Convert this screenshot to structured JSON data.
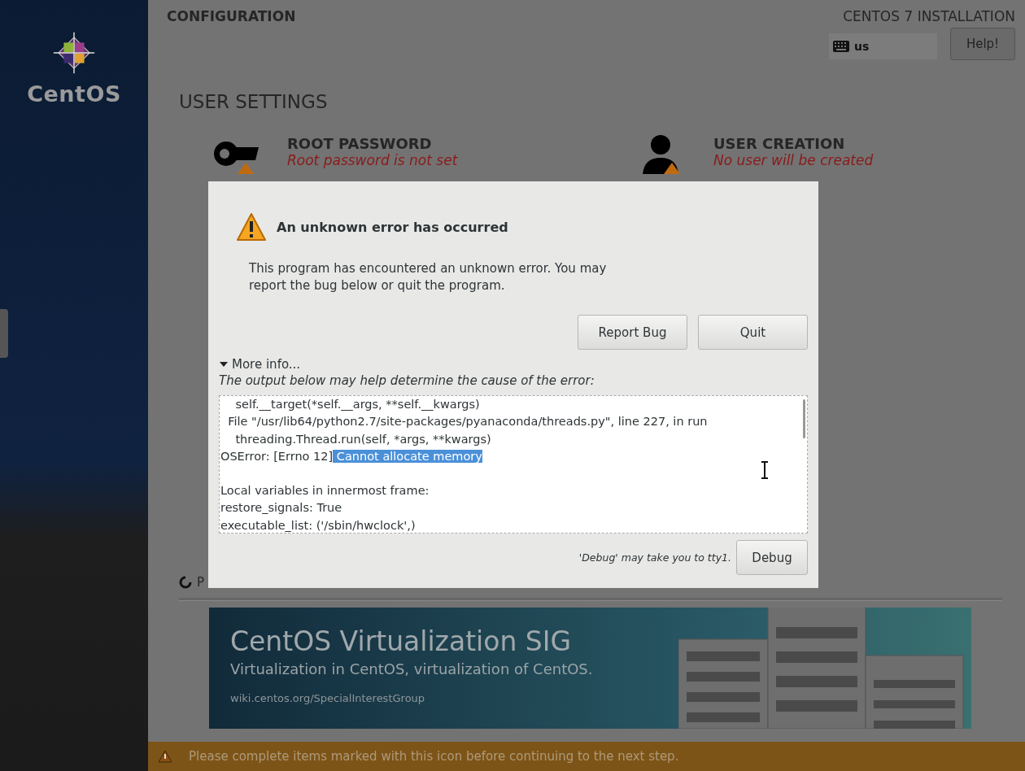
{
  "sidebar": {
    "logo_text": "CentOS"
  },
  "header": {
    "title": "CONFIGURATION",
    "product": "CENTOS 7 INSTALLATION",
    "keyboard_layout": "us",
    "help_button": "Help!"
  },
  "section_title": "USER SETTINGS",
  "spokes": [
    {
      "kind": "root",
      "title": "ROOT PASSWORD",
      "status": "Root password is not set",
      "warning": true
    },
    {
      "kind": "user",
      "title": "USER CREATION",
      "status": "No user will be created",
      "warning": true
    }
  ],
  "progress": {
    "text": "P"
  },
  "banner": {
    "title": "CentOS Virtualization SIG",
    "subtitle": "Virtualization in CentOS, virtualization of CentOS.",
    "url": "wiki.centos.org/SpecialInterestGroup"
  },
  "status_bar": {
    "message": "Please complete items marked with this icon before continuing to the next step."
  },
  "dialog": {
    "title": "An unknown error has occurred",
    "message": "This program has encountered an unknown error. You may report the bug below or quit the program.",
    "buttons": [
      "Report Bug",
      "Quit"
    ],
    "more_info": {
      "label": "More info...",
      "expanded": true
    },
    "hint": "The output below may help determine the cause of the error:",
    "log_lines": [
      {
        "text": "    self.__target(*self.__args, **self.__kwargs)"
      },
      {
        "text": "  File \"/usr/lib64/python2.7/site-packages/pyanaconda/threads.py\", line 227, in run"
      },
      {
        "text": "    threading.Thread.run(self, *args, **kwargs)"
      },
      {
        "text": "OSError: [Errno 12]",
        "selection": " Cannot allocate memory"
      },
      {
        "text": "Local variables in innermost frame:",
        "gap_before": true
      },
      {
        "text": "restore_signals: True"
      },
      {
        "text": "executable_list: ('/sbin/hwclock',)"
      }
    ],
    "debug_hint": "'Debug' may take you to tty1.",
    "debug_button": "Debug"
  }
}
